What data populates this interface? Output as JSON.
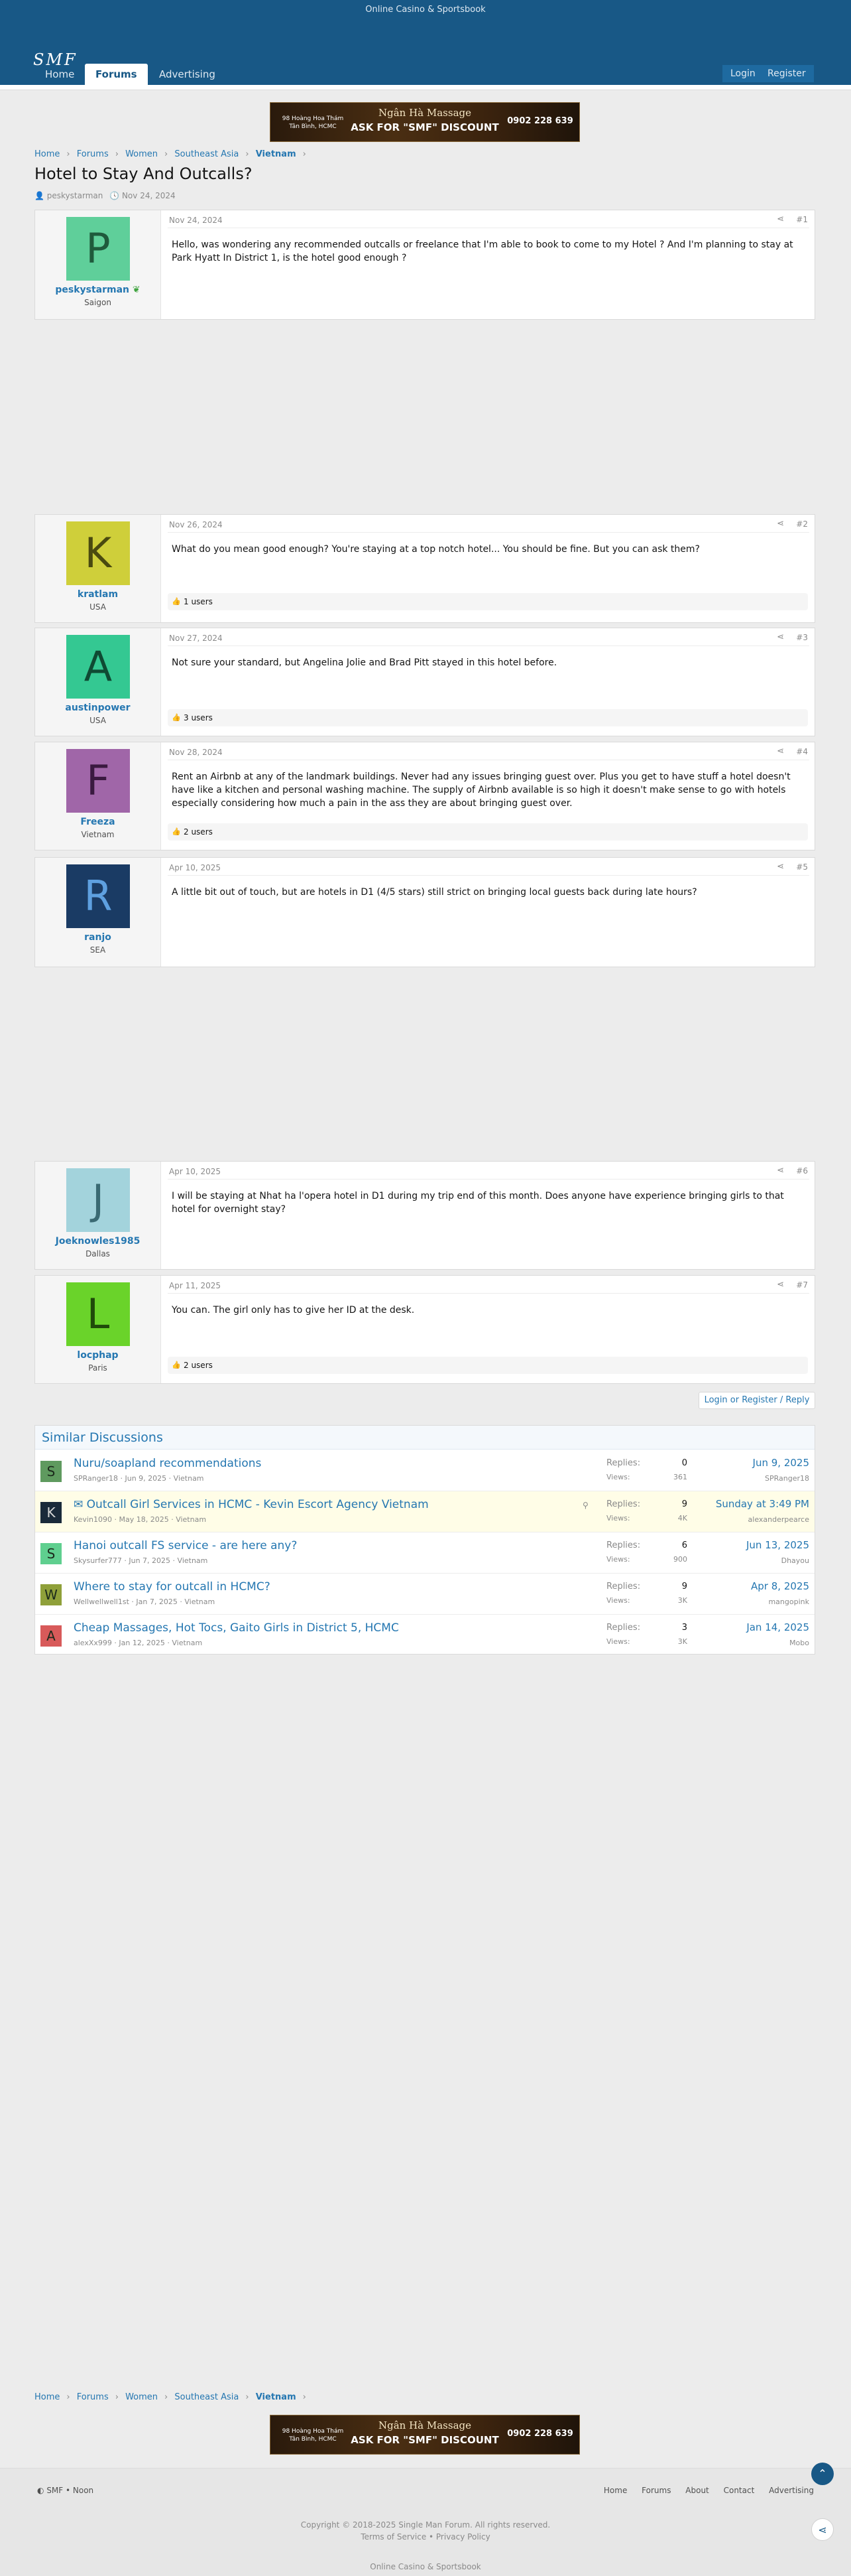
{
  "topbar": {
    "text": "Online Casino & Sportsbook"
  },
  "site": {
    "logo": "SMF"
  },
  "nav": {
    "home": "Home",
    "forums": "Forums",
    "advertising": "Advertising",
    "login": "Login",
    "register": "Register"
  },
  "banner": {
    "address": "98 Hoàng Hoa Thám Tân Bình, HCMC",
    "name": "Ngân Hà Massage",
    "promo": "ASK FOR \"SMF\" DISCOUNT",
    "phone": "0902 228 639"
  },
  "breadcrumbs": [
    "Home",
    "Forums",
    "Women",
    "Southeast Asia",
    "Vietnam"
  ],
  "thread": {
    "title": "Hotel to Stay And Outcalls?",
    "author": "peskystarman",
    "date": "Nov 24, 2024"
  },
  "posts": [
    {
      "user": "peskystarman",
      "initial": "P",
      "location": "Saigon",
      "avatar_color": "#5fcf9a",
      "date": "Nov 24, 2024",
      "num": "#1",
      "body": "Hello, was wondering any recommended outcalls or freelance that I'm able to book to come to my Hotel ? And I'm planning to stay at Park Hyatt In District 1, is the hotel good enough ?",
      "reactions": ""
    },
    {
      "user": "kratlam",
      "initial": "K",
      "location": "USA",
      "avatar_color": "#cfcf3a",
      "date": "Nov 26, 2024",
      "num": "#2",
      "body": "What do you mean good enough? You're staying at a top notch hotel... You should be fine. But you can ask them?",
      "reactions": "1 users"
    },
    {
      "user": "austinpower",
      "initial": "A",
      "location": "USA",
      "avatar_color": "#34c892",
      "date": "Nov 27, 2024",
      "num": "#3",
      "body": "Not sure your standard, but Angelina Jolie and Brad Pitt stayed in this hotel before.",
      "reactions": "3 users"
    },
    {
      "user": "Freeza",
      "initial": "F",
      "location": "Vietnam",
      "avatar_color": "#a066a8",
      "date": "Nov 28, 2024",
      "num": "#4",
      "body": "Rent an Airbnb at any of the landmark buildings. Never had any issues bringing guest over. Plus you get to have stuff a hotel doesn't have like a kitchen and personal washing machine. The supply of Airbnb available is so high it doesn't make sense to go with hotels especially considering how much a pain in the ass they are about bringing guest over.",
      "reactions": "2 users"
    },
    {
      "user": "ranjo",
      "initial": "R",
      "location": "SEA",
      "avatar_color": "#1a3b64",
      "date": "Apr 10, 2025",
      "num": "#5",
      "body": "A little bit out of touch, but are hotels in D1 (4/5 stars) still strict on bringing local guests back during late hours?",
      "reactions": ""
    },
    {
      "user": "Joeknowles1985",
      "initial": "J",
      "location": "Dallas",
      "avatar_color": "#a3d3dc",
      "date": "Apr 10, 2025",
      "num": "#6",
      "body": "I will be staying at Nhat ha l'opera hotel in D1 during my trip end of this month. Does anyone have experience bringing girls to that hotel for overnight stay?",
      "reactions": ""
    },
    {
      "user": "locphap",
      "initial": "L",
      "location": "Paris",
      "avatar_color": "#6ad32a",
      "date": "Apr 11, 2025",
      "num": "#7",
      "body": "You can. The girl only has to give her ID at the desk.",
      "reactions": "2 users"
    }
  ],
  "login_reply": "Login or Register / Reply",
  "similar": {
    "heading": "Similar Discussions",
    "replies_label": "Replies:",
    "views_label": "Views:",
    "threads": [
      {
        "initial": "S",
        "color": "#5f9a5f",
        "title": "Nuru/soapland recommendations",
        "author": "SPRanger18",
        "date": "Jun 9, 2025",
        "forum": "Vietnam",
        "replies": "0",
        "views": "361",
        "last_date": "Jun 9, 2025",
        "last_user": "SPRanger18"
      },
      {
        "initial": "K",
        "color": "#1a2a3a",
        "title": "Outcall Girl Services in HCMC - Kevin Escort Agency Vietnam",
        "author": "Kevin1090",
        "date": "May 18, 2025",
        "forum": "Vietnam",
        "replies": "9",
        "views": "4K",
        "last_date": "Sunday at 3:49 PM",
        "last_user": "alexanderpearce"
      },
      {
        "initial": "S",
        "color": "#5fcf8f",
        "title": "Hanoi outcall FS service - are here any?",
        "author": "Skysurfer777",
        "date": "Jun 7, 2025",
        "forum": "Vietnam",
        "replies": "6",
        "views": "900",
        "last_date": "Jun 13, 2025",
        "last_user": "Dhayou"
      },
      {
        "initial": "W",
        "color": "#8fa03a",
        "title": "Where to stay for outcall in HCMC?",
        "author": "Wellwellwell1st",
        "date": "Jan 7, 2025",
        "forum": "Vietnam",
        "replies": "9",
        "views": "3K",
        "last_date": "Apr 8, 2025",
        "last_user": "mangopink"
      },
      {
        "initial": "A",
        "color": "#d85a5a",
        "title": "Cheap Massages, Hot Tocs, Gaito Girls in District 5, HCMC",
        "author": "alexXx999",
        "date": "Jan 12, 2025",
        "forum": "Vietnam",
        "replies": "3",
        "views": "3K",
        "last_date": "Jan 14, 2025",
        "last_user": "Mobo"
      }
    ]
  },
  "footer": {
    "brand": "SMF • Noon",
    "links": [
      "Home",
      "Forums",
      "About",
      "Contact",
      "Advertising"
    ],
    "copyright": "Copyright © 2018-2025 Single Man Forum. All rights reserved.",
    "terms": "Terms of Service • Privacy Policy",
    "promo": "Online Casino & Sportsbook"
  }
}
